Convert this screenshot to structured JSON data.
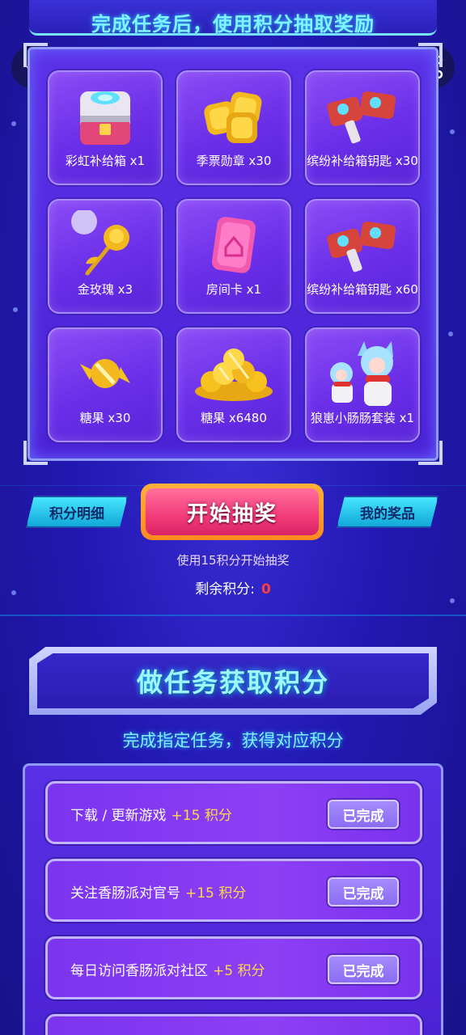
{
  "banner": {
    "title": "完成任务后，使用积分抽取奖励"
  },
  "prizes": [
    {
      "label": "彩虹补给箱 x1",
      "icon": "supply-box-icon"
    },
    {
      "label": "季票勋章 x30",
      "icon": "gold-medal-icon"
    },
    {
      "label": "缤纷补给箱钥匙 x30",
      "icon": "key-icon"
    },
    {
      "label": "金玫瑰 x3",
      "icon": "gold-rose-icon"
    },
    {
      "label": "房间卡 x1",
      "icon": "room-card-icon"
    },
    {
      "label": "缤纷补给箱钥匙 x60",
      "icon": "key-icon"
    },
    {
      "label": "糖果 x30",
      "icon": "candy-icon"
    },
    {
      "label": "糖果 x6480",
      "icon": "candy-pile-icon"
    },
    {
      "label": "狼崽小肠肠套装 x1",
      "icon": "wolf-costume-icon"
    }
  ],
  "actions": {
    "details_label": "积分明细",
    "draw_label": "开始抽奖",
    "my_prizes_label": "我的奖品",
    "draw_hint": "使用15积分开始抽奖",
    "remaining_label": "剩余积分:",
    "remaining_value": "0"
  },
  "tasks_section": {
    "title": "做任务获取积分",
    "subtitle": "完成指定任务，获得对应积分",
    "items": [
      {
        "name": "下载 / 更新游戏",
        "points": "+15 积分",
        "status": "已完成"
      },
      {
        "name": "关注香肠派对官号",
        "points": "+15 积分",
        "status": "已完成"
      },
      {
        "name": "每日访问香肠派对社区",
        "points": "+5 积分",
        "status": "已完成"
      }
    ]
  },
  "colors": {
    "background": "#2319b4",
    "accent_cyan": "#7ff3ff",
    "draw_button": "#f23b78",
    "points_value": "#ff3b3b",
    "task_points": "#ffd84a"
  }
}
